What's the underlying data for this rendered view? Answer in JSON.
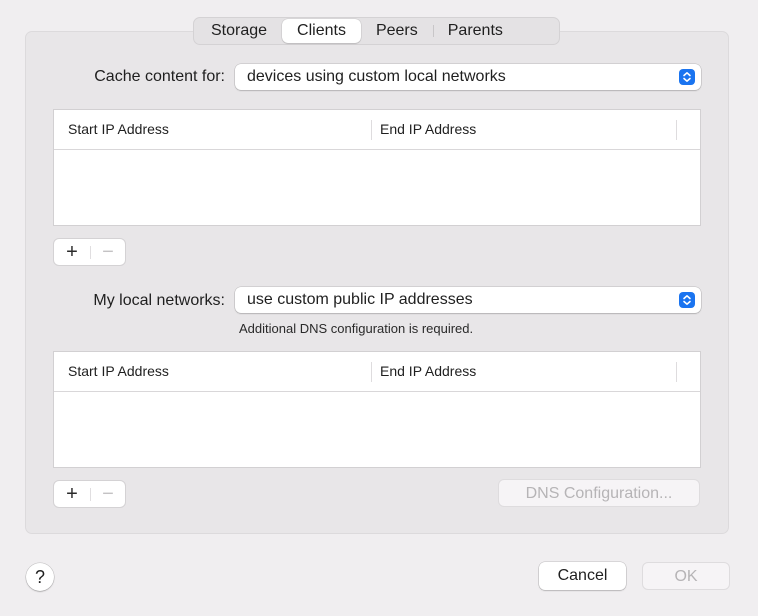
{
  "tabs": [
    {
      "label": "Storage",
      "active": false
    },
    {
      "label": "Clients",
      "active": true
    },
    {
      "label": "Peers",
      "active": false
    },
    {
      "label": "Parents",
      "active": false
    }
  ],
  "cache_content": {
    "label": "Cache content for:",
    "value": "devices using custom local networks",
    "table": {
      "columns": [
        "Start IP Address",
        "End IP Address"
      ],
      "rows": []
    },
    "add_label": "+",
    "remove_label": "−"
  },
  "local_networks": {
    "label": "My local networks:",
    "value": "use custom public IP addresses",
    "note": "Additional DNS configuration is required.",
    "table": {
      "columns": [
        "Start IP Address",
        "End IP Address"
      ],
      "rows": []
    },
    "add_label": "+",
    "remove_label": "−",
    "dns_button": "DNS Configuration..."
  },
  "footer": {
    "help": "?",
    "cancel": "Cancel",
    "ok": "OK"
  },
  "colors": {
    "accent": "#1a74f0",
    "background": "#f0eef0"
  }
}
